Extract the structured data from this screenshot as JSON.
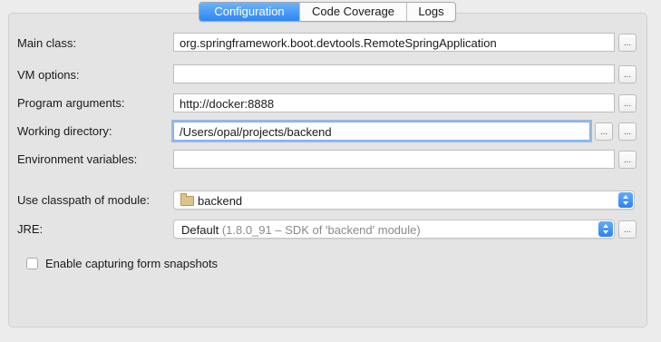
{
  "tabs": [
    {
      "label": "Configuration",
      "active": true
    },
    {
      "label": "Code Coverage",
      "active": false
    },
    {
      "label": "Logs",
      "active": false
    }
  ],
  "form": {
    "main_class": {
      "label": "Main class:",
      "value": "org.springframework.boot.devtools.RemoteSpringApplication"
    },
    "vm_options": {
      "label": "VM options:",
      "value": ""
    },
    "program_arguments": {
      "label": "Program arguments:",
      "value": "http://docker:8888"
    },
    "working_directory": {
      "label": "Working directory:",
      "value": "/Users/opal/projects/backend"
    },
    "environment_variables": {
      "label": "Environment variables:",
      "value": ""
    },
    "classpath_module": {
      "label": "Use classpath of module:",
      "value": "backend",
      "icon": "folder-icon"
    },
    "jre": {
      "label": "JRE:",
      "value": "Default",
      "detail": "(1.8.0_91 – SDK of 'backend' module)"
    },
    "snapshots": {
      "label": "Enable capturing form snapshots",
      "checked": false
    }
  },
  "browse_label": "..."
}
